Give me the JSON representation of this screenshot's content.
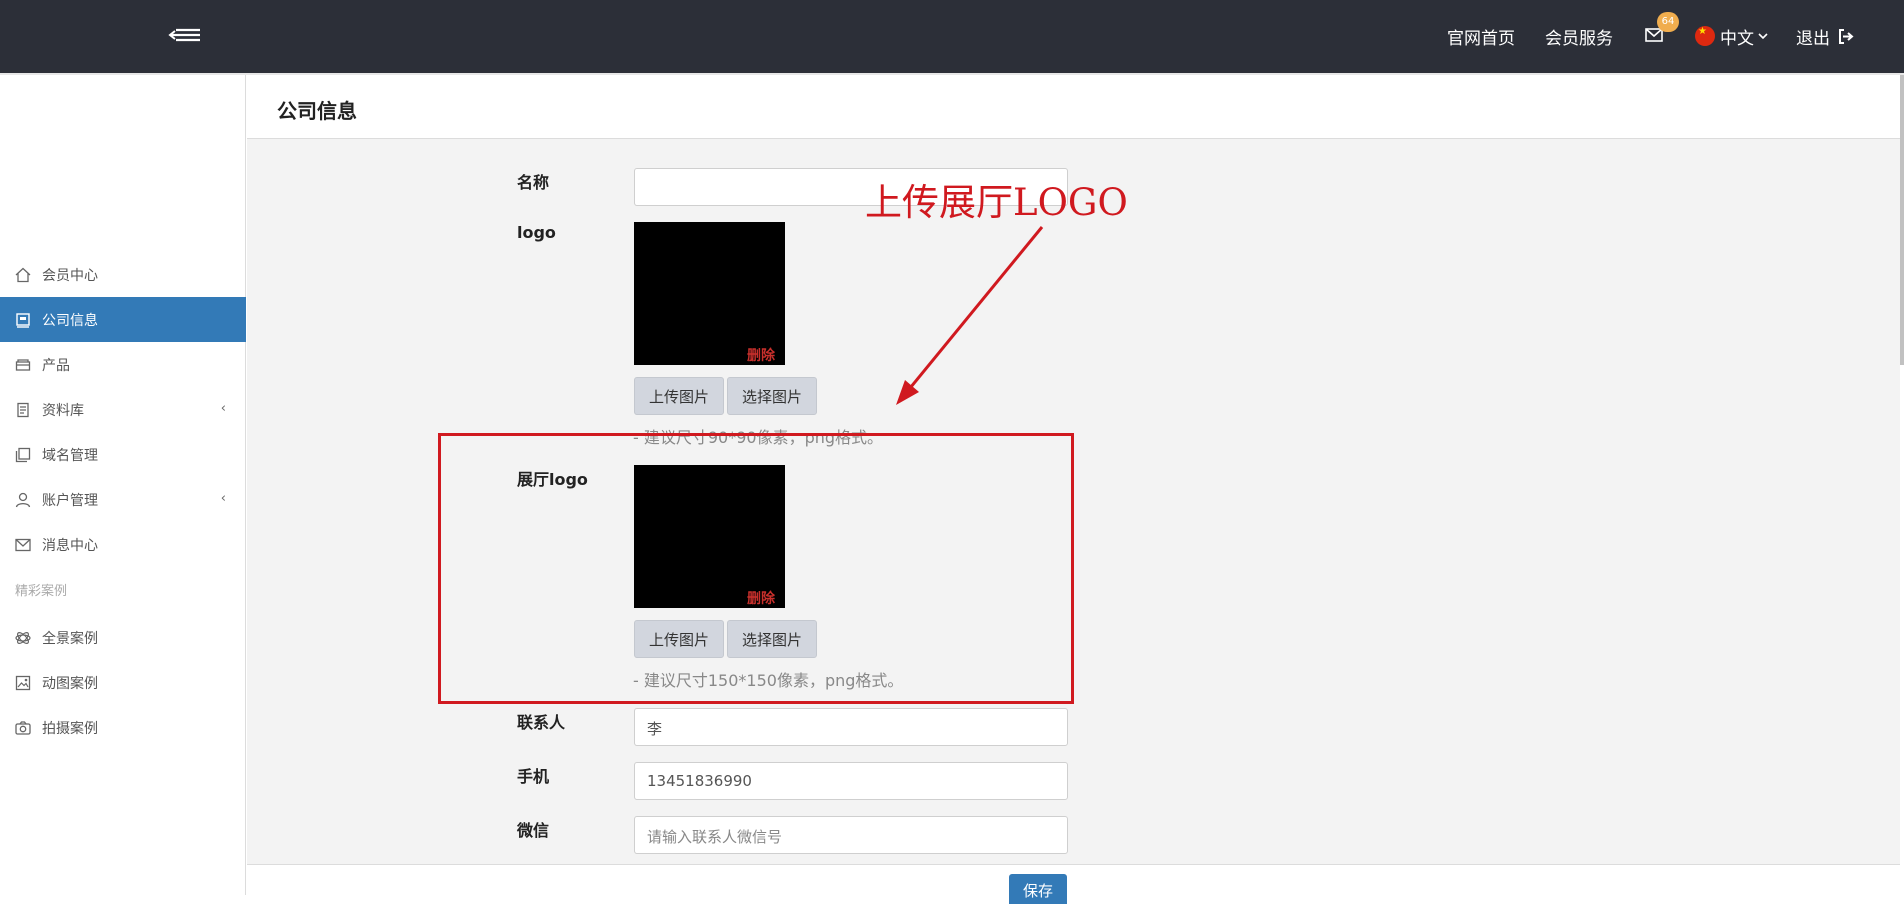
{
  "header": {
    "nav_home": "官网首页",
    "nav_service": "会员服务",
    "mail_badge": "64",
    "lang": "中文",
    "logout": "退出"
  },
  "sidebar": {
    "items": [
      {
        "label": "会员中心",
        "icon": "home-icon"
      },
      {
        "label": "公司信息",
        "icon": "company-icon",
        "active": true
      },
      {
        "label": "产品",
        "icon": "product-icon"
      },
      {
        "label": "资料库",
        "icon": "library-icon",
        "has_children": true
      },
      {
        "label": "域名管理",
        "icon": "domain-icon"
      },
      {
        "label": "账户管理",
        "icon": "user-icon",
        "has_children": true
      },
      {
        "label": "消息中心",
        "icon": "message-icon"
      }
    ],
    "section_title": "精彩案例",
    "case_items": [
      {
        "label": "全景案例",
        "icon": "panorama-icon"
      },
      {
        "label": "动图案例",
        "icon": "gif-icon"
      },
      {
        "label": "拍摄案例",
        "icon": "camera-icon"
      }
    ]
  },
  "page": {
    "title": "公司信息",
    "form": {
      "name_label": "名称",
      "name_value": "",
      "logo_label": "logo",
      "logo_delete": "删除",
      "upload_btn": "上传图片",
      "choose_btn": "选择图片",
      "logo_hint": "- 建议尺寸90*90像素，png格式。",
      "hall_logo_label": "展厅logo",
      "hall_logo_delete": "删除",
      "hall_upload_btn": "上传图片",
      "hall_choose_btn": "选择图片",
      "hall_logo_hint": "- 建议尺寸150*150像素，png格式。",
      "contact_label": "联系人",
      "contact_value": "李",
      "phone_label": "手机",
      "phone_value": "13451836990",
      "wechat_label": "微信",
      "wechat_placeholder": "请输入联系人微信号",
      "save_btn": "保存"
    }
  },
  "annotation": {
    "text": "上传展厅LOGO",
    "color": "#d0191f"
  },
  "colors": {
    "header_bg": "#2c2f38",
    "active_blue": "#337ab7",
    "badge": "#f0ad4e"
  }
}
